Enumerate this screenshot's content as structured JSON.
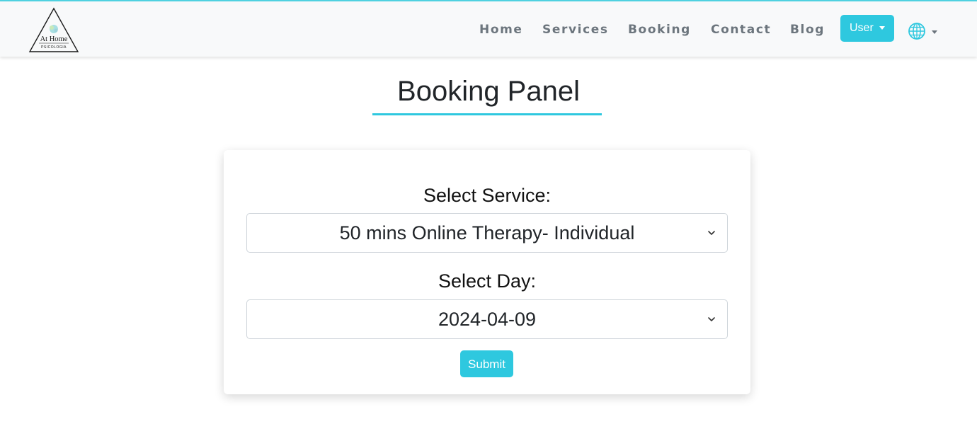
{
  "brand": {
    "logo_line1": "At Home",
    "logo_line2": "PSICOLOGIA"
  },
  "nav": {
    "links": [
      "Home",
      "Services",
      "Booking",
      "Contact",
      "Blog"
    ],
    "user_label": "User",
    "language_icon": "globe-icon"
  },
  "page": {
    "title": "Booking Panel"
  },
  "form": {
    "service_label": "Select Service:",
    "service_value": "50 mins Online Therapy- Individual",
    "day_label": "Select Day:",
    "day_value": "2024-04-09",
    "submit_label": "Submit"
  },
  "colors": {
    "accent": "#2ec8df",
    "nav_text": "#6c757d",
    "nav_bg": "#f8f9fa"
  }
}
